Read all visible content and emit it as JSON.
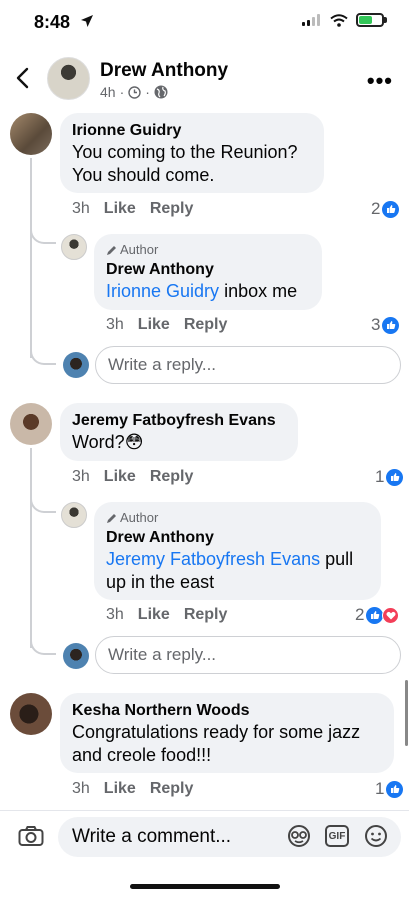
{
  "status_bar": {
    "time": "8:48"
  },
  "header": {
    "name": "Drew Anthony",
    "age": "4h",
    "separator": "·"
  },
  "comments": [
    {
      "author": "Irionne Guidry",
      "text_line1": "You coming to the Reunion?",
      "text_line2": "You should come.",
      "age": "3h",
      "like_label": "Like",
      "reply_label": "Reply",
      "reaction_count": "2",
      "replies": [
        {
          "author_tag": "Author",
          "author": "Drew Anthony",
          "mention": "Irionne Guidry",
          "text": " inbox me",
          "age": "3h",
          "like_label": "Like",
          "reply_label": "Reply",
          "reaction_count": "3"
        }
      ],
      "reply_placeholder": "Write a reply..."
    },
    {
      "author": "Jeremy Fatboyfresh Evans",
      "text": "Word?😳",
      "age": "3h",
      "like_label": "Like",
      "reply_label": "Reply",
      "reaction_count": "1",
      "replies": [
        {
          "author_tag": "Author",
          "author": "Drew Anthony",
          "mention": "Jeremy Fatboyfresh Evans",
          "text": " pull",
          "text_line2": "up in the east",
          "age": "3h",
          "like_label": "Like",
          "reply_label": "Reply",
          "reaction_count": "2"
        }
      ],
      "reply_placeholder": "Write a reply..."
    },
    {
      "author": "Kesha Northern Woods",
      "text_line1": "Congratulations ready for some jazz",
      "text_line2": "and creole food!!!",
      "age": "3h",
      "like_label": "Like",
      "reply_label": "Reply",
      "reaction_count": "1"
    }
  ],
  "comment_bar": {
    "placeholder": "Write a comment...",
    "gif_label": "GIF"
  },
  "colors": {
    "accent": "#1877f2",
    "bubble": "#f0f2f5",
    "love": "#f33e58"
  }
}
